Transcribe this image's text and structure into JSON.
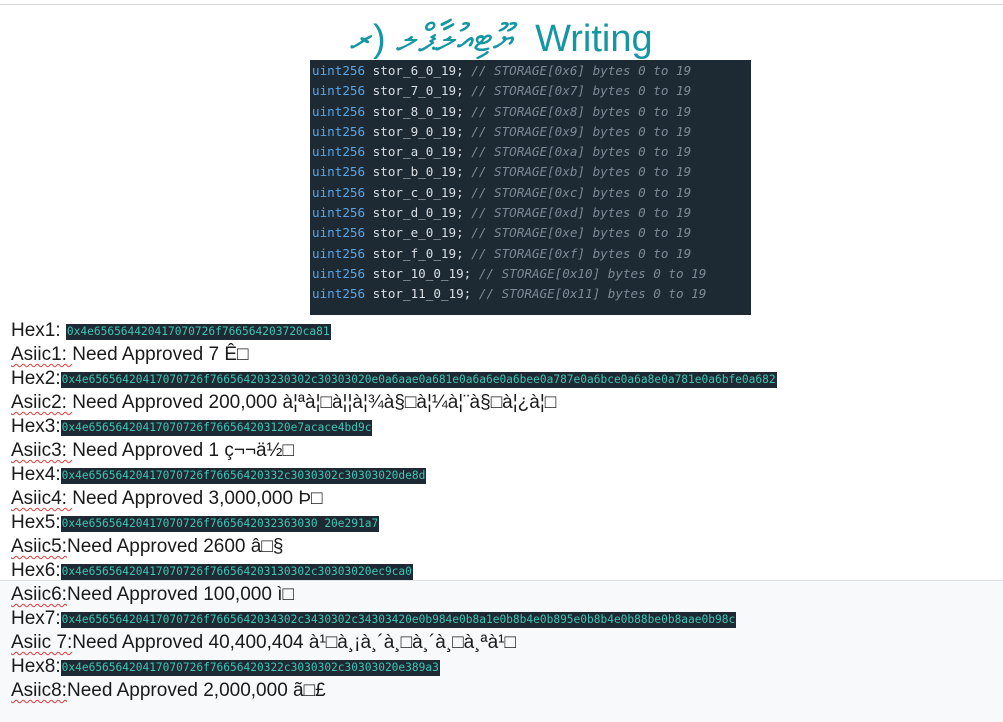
{
  "heading": "ޔޫޓިއުލާޕްލ (ރ ‌ Writing",
  "code_lines": [
    {
      "type": "uint256",
      "name": "stor_6_0_19;",
      "comment": "// STORAGE[0x6] bytes 0 to 19"
    },
    {
      "type": "uint256",
      "name": "stor_7_0_19;",
      "comment": "// STORAGE[0x7] bytes 0 to 19"
    },
    {
      "type": "uint256",
      "name": "stor_8_0_19;",
      "comment": "// STORAGE[0x8] bytes 0 to 19"
    },
    {
      "type": "uint256",
      "name": "stor_9_0_19;",
      "comment": "// STORAGE[0x9] bytes 0 to 19"
    },
    {
      "type": "uint256",
      "name": "stor_a_0_19;",
      "comment": "// STORAGE[0xa] bytes 0 to 19"
    },
    {
      "type": "uint256",
      "name": "stor_b_0_19;",
      "comment": "// STORAGE[0xb] bytes 0 to 19"
    },
    {
      "type": "uint256",
      "name": "stor_c_0_19;",
      "comment": "// STORAGE[0xc] bytes 0 to 19"
    },
    {
      "type": "uint256",
      "name": "stor_d_0_19;",
      "comment": "// STORAGE[0xd] bytes 0 to 19"
    },
    {
      "type": "uint256",
      "name": "stor_e_0_19;",
      "comment": "// STORAGE[0xe] bytes 0 to 19"
    },
    {
      "type": "uint256",
      "name": "stor_f_0_19;",
      "comment": "// STORAGE[0xf] bytes 0 to 19"
    },
    {
      "type": "uint256",
      "name": "stor_10_0_19;",
      "comment": "// STORAGE[0x10] bytes 0 to 19"
    },
    {
      "type": "uint256",
      "name": "stor_11_0_19;",
      "comment": "// STORAGE[0x11] bytes 0 to 19"
    }
  ],
  "rows": [
    {
      "label": "Hex1: ",
      "hex": "0x4e656564420417070726f766564203720ca81"
    },
    {
      "label": "Asiic1: ",
      "text": "Need Approved 7 Ê□"
    },
    {
      "label": "Hex2:",
      "hex": "0x4e65656420417070726f766564203230302c30303020e0a6aae0a681e0a6a6e0a6bee0a787e0a6bce0a6a8e0a781e0a6bfe0a682"
    },
    {
      "label": "Asiic2: ",
      "text": "Need Approved 200,000 à¦ªà¦□à¦¦à¦¾à§□à¦¼à¦¨à§□à¦¿à¦□"
    },
    {
      "label": "Hex3:",
      "hex": "0x4e65656420417070726f766564203120e7acace4bd9c"
    },
    {
      "label": "Asiic3: ",
      "text": "Need Approved 1 ç¬¬ä½□"
    },
    {
      "label": "Hex4:",
      "hex": "0x4e65656420417070726f76656420332c3030302c30303020de8d"
    },
    {
      "label": "Asiic4: ",
      "text": "Need Approved 3,000,000 Þ□"
    },
    {
      "label": "Hex5:",
      "hex": "0x4e65656420417070726f7665642032363030 20e291a7"
    },
    {
      "label": "Asiic5:",
      "text": "Need Approved 2600 â□§"
    },
    {
      "label": "Hex6:",
      "hex": "0x4e65656420417070726f766564203130302c30303020ec9ca0"
    },
    {
      "label": "Asiic6:",
      "text": "Need Approved 100,000 ì□"
    },
    {
      "label": "Hex7:",
      "hex": "0x4e65656420417070726f7665642034302c3430302c34303420e0b984e0b8a1e0b8b4e0b895e0b8b4e0b88be0b8aae0b98c"
    },
    {
      "label": "Asiic 7:",
      "text": "Need Approved 40,400,404 à¹□à¸¡à¸´à¸□à¸´à¸□à¸ªà¹□"
    },
    {
      "label": "Hex8:",
      "hex": "0x4e65656420417070726f76656420322c3030302c30303020e389a3"
    },
    {
      "label": "Asiic8:",
      "text": "Need Approved 2,000,000 ã□£"
    }
  ]
}
